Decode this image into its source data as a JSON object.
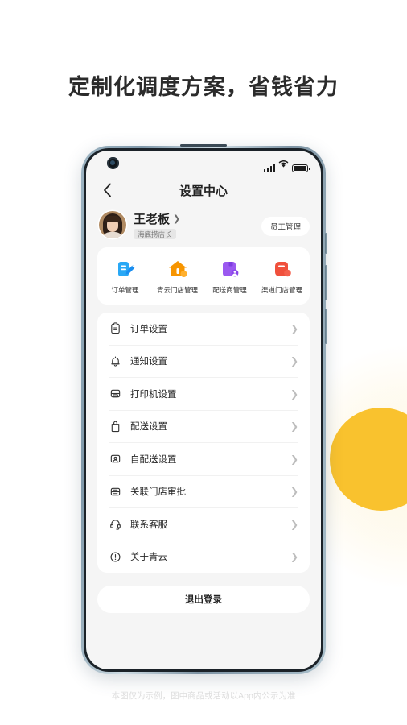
{
  "headline": "定制化调度方案，省钱省力",
  "footnote": "本图仅为示例，图中商品或活动以App内公示为准",
  "colors": {
    "page_background": "#ffffff",
    "screen_background": "#f5f5f5",
    "card": "#ffffff",
    "accent_yellow": "#f9c22e",
    "icon_blue": "#2196f3",
    "icon_orange": "#f79500",
    "icon_purple": "#9b59f0",
    "icon_red": "#f0503c",
    "text_primary": "#222222",
    "text_muted": "#7a7a7a"
  },
  "phone": {
    "statusbar": {
      "signal_icon": "signal-bars-icon",
      "wifi_icon": "wifi-icon",
      "battery_icon": "battery-full-icon",
      "camera": "punch-hole-camera"
    },
    "navbar": {
      "back_icon": "chevron-left-icon",
      "title": "设置中心"
    },
    "profile": {
      "avatar": "user-avatar",
      "name": "王老板",
      "name_chevron": "chevron-right-icon",
      "role_badge": "海底捞店长",
      "staff_button": "员工管理"
    },
    "quick_actions": [
      {
        "label": "订单管理",
        "icon": "order-document-icon",
        "color": "#2196f3"
      },
      {
        "label": "青云门店管理",
        "icon": "store-house-icon",
        "color": "#f79500"
      },
      {
        "label": "配送商管理",
        "icon": "delivery-provider-icon",
        "color": "#9b59f0"
      },
      {
        "label": "渠道门店管理",
        "icon": "channel-store-icon",
        "color": "#f0503c"
      }
    ],
    "menu": [
      {
        "label": "订单设置",
        "icon": "clipboard-icon"
      },
      {
        "label": "通知设置",
        "icon": "bell-icon"
      },
      {
        "label": "打印机设置",
        "icon": "printer-icon"
      },
      {
        "label": "配送设置",
        "icon": "shopping-bag-icon"
      },
      {
        "label": "自配送设置",
        "icon": "self-delivery-icon"
      },
      {
        "label": "关联门店审批",
        "icon": "store-approval-icon"
      },
      {
        "label": "联系客服",
        "icon": "headset-icon"
      },
      {
        "label": "关于青云",
        "icon": "info-circle-icon"
      }
    ],
    "menu_chevron": "chevron-right-icon",
    "logout_button": "退出登录"
  }
}
